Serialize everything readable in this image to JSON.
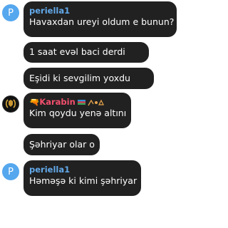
{
  "messages": [
    {
      "sender": "periella1",
      "text": "Havaxdan ureyi oldum e bunun?",
      "avatar_letter": "P"
    },
    {
      "text": "1 saat evəl baci derdi"
    },
    {
      "text": "Eşidi ki sevgilim yoxdu"
    },
    {
      "sender": "🔫Karabin",
      "text": "Kim qoydu yenə altını",
      "avatar_icon": "wreath-emblem-icon"
    },
    {
      "text": "Şəhriyar olar o"
    },
    {
      "sender": "periella1",
      "text": "Həməşə ki kimi şəhriyar",
      "avatar_letter": "P"
    }
  ],
  "colors": {
    "bubble": "#212121",
    "sender_blue": "#63a9ea",
    "sender_pink": "#f24f6d",
    "avatar_blue": "#55a7ee"
  }
}
